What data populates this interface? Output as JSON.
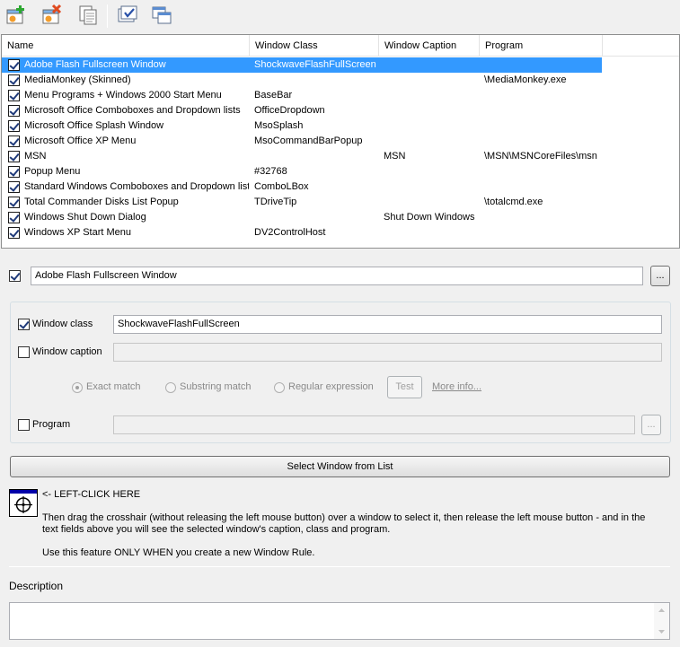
{
  "toolbar": {
    "buttons": [
      {
        "name": "add-rule",
        "icon": "add-window-icon"
      },
      {
        "name": "delete-rule",
        "icon": "delete-window-icon"
      },
      {
        "name": "copy-rule",
        "icon": "copy-icon"
      },
      {
        "name": "check-all",
        "icon": "check-list-icon"
      },
      {
        "name": "windows",
        "icon": "cascade-windows-icon"
      }
    ]
  },
  "list": {
    "columns": [
      "Name",
      "Window Class",
      "Window Caption",
      "Program"
    ],
    "rows": [
      {
        "checked": true,
        "name": "Adobe Flash Fullscreen Window",
        "cls": "ShockwaveFlashFullScreen",
        "caption": "",
        "program": "",
        "selected": true
      },
      {
        "checked": true,
        "name": "MediaMonkey (Skinned)",
        "cls": "",
        "caption": "",
        "program": "\\MediaMonkey.exe",
        "selected": false
      },
      {
        "checked": true,
        "name": "Menu Programs + Windows 2000 Start Menu",
        "cls": "BaseBar",
        "caption": "",
        "program": "",
        "selected": false
      },
      {
        "checked": true,
        "name": "Microsoft Office Comboboxes and Dropdown lists",
        "cls": "OfficeDropdown",
        "caption": "",
        "program": "",
        "selected": false
      },
      {
        "checked": true,
        "name": "Microsoft Office Splash Window",
        "cls": "MsoSplash",
        "caption": "",
        "program": "",
        "selected": false
      },
      {
        "checked": true,
        "name": "Microsoft Office XP Menu",
        "cls": "MsoCommandBarPopup",
        "caption": "",
        "program": "",
        "selected": false
      },
      {
        "checked": true,
        "name": "MSN",
        "cls": "",
        "caption": "MSN",
        "program": "\\MSN\\MSNCoreFiles\\msn",
        "selected": false
      },
      {
        "checked": true,
        "name": "Popup Menu",
        "cls": "#32768",
        "caption": "",
        "program": "",
        "selected": false
      },
      {
        "checked": true,
        "name": "Standard Windows Comboboxes and Dropdown lists",
        "cls": "ComboLBox",
        "caption": "",
        "program": "",
        "selected": false
      },
      {
        "checked": true,
        "name": "Total Commander Disks List Popup",
        "cls": "TDriveTip",
        "caption": "",
        "program": "\\totalcmd.exe",
        "selected": false
      },
      {
        "checked": true,
        "name": "Windows Shut Down Dialog",
        "cls": "",
        "caption": "Shut Down Windows",
        "program": "",
        "selected": false
      },
      {
        "checked": true,
        "name": "Windows XP Start Menu",
        "cls": "DV2ControlHost",
        "caption": "",
        "program": "",
        "selected": false
      }
    ]
  },
  "rule": {
    "enabled": true,
    "name_value": "Adobe Flash Fullscreen Window",
    "browse_label": "..."
  },
  "match": {
    "window_class": {
      "label": "Window class",
      "checked": true,
      "value": "ShockwaveFlashFullScreen"
    },
    "window_caption": {
      "label": "Window caption",
      "checked": false,
      "value": ""
    },
    "modes": [
      {
        "label": "Exact match",
        "selected": true
      },
      {
        "label": "Substring match",
        "selected": false
      },
      {
        "label": "Regular expression",
        "selected": false
      }
    ],
    "test_label": "Test",
    "more_info_label": "More info...",
    "program": {
      "label": "Program",
      "checked": false,
      "value": "",
      "browse_label": "..."
    }
  },
  "select_button_label": "Select Window from List",
  "crosshair": {
    "heading": "<- LEFT-CLICK HERE",
    "instructions": "Then drag the crosshair (without releasing the left mouse button) over a window to select it, then release the left mouse button - and in the text fields above you will see the selected window's caption, class and program.",
    "note": "Use this feature ONLY WHEN you create a new Window Rule."
  },
  "description": {
    "label": "Description",
    "value": ""
  }
}
